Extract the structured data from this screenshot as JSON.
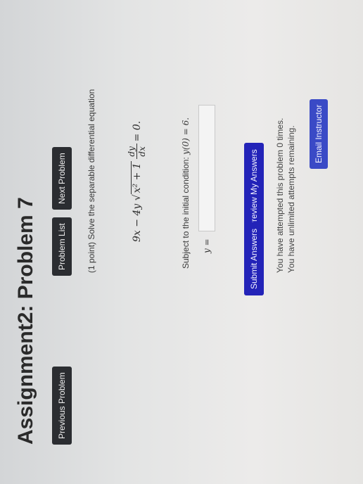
{
  "title": "Assignment2: Problem 7",
  "nav": {
    "previous_label": "Previous Problem",
    "list_label": "Problem List",
    "next_label": "Next Problem"
  },
  "problem": {
    "intro": "(1 point) Solve the separable differential equation",
    "equation": {
      "lhs_start": "9x − 4y",
      "radicand": "x² + 1",
      "frac_num": "dy",
      "frac_den": "dx",
      "rhs": "= 0."
    },
    "condition_text": "Subject to the initial condition: ",
    "condition_math": "y(0) = 6.",
    "answer_label": "y =",
    "answer_value": ""
  },
  "actions": {
    "preview_label": "Preview My Answers",
    "submit_label": "Submit Answers"
  },
  "attempts": {
    "line1": "You have attempted this problem 0 times.",
    "line2": "You have unlimited attempts remaining."
  },
  "email_label": "Email Instructor"
}
